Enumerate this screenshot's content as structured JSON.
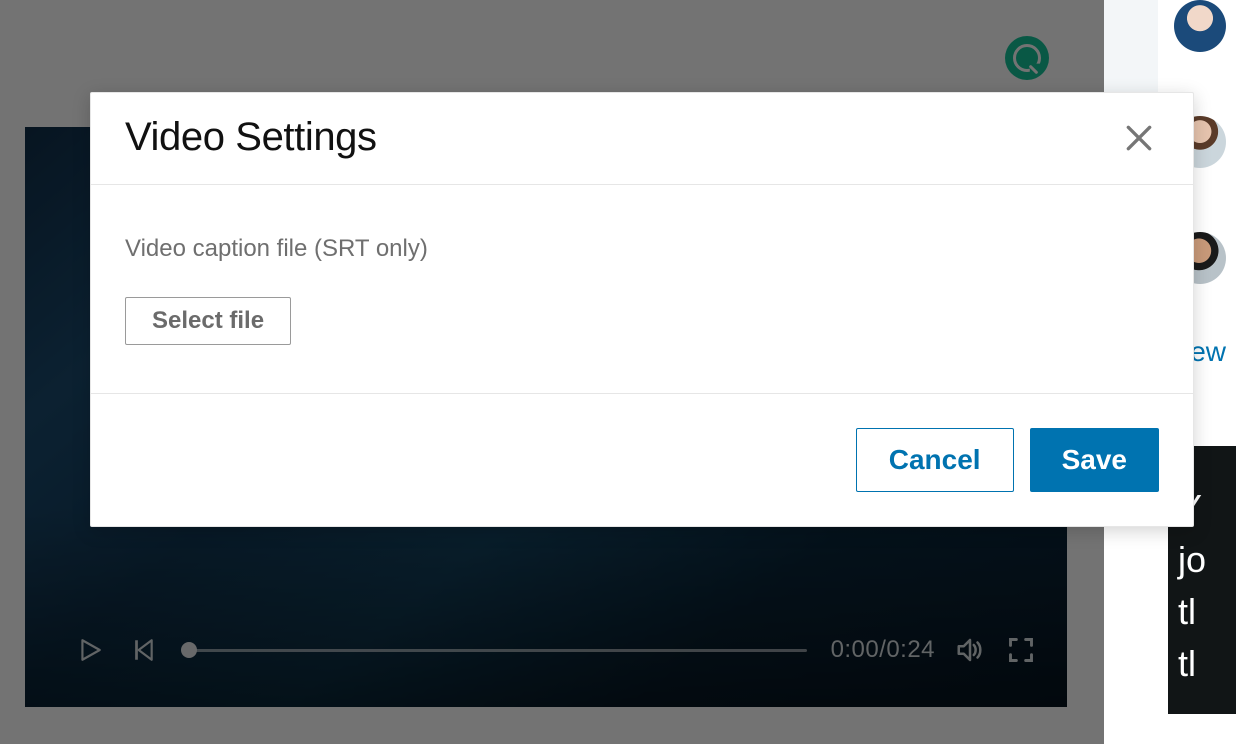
{
  "modal": {
    "title": "Video Settings",
    "caption_label": "Video caption file (SRT only)",
    "select_file_label": "Select file",
    "cancel_label": "Cancel",
    "save_label": "Save"
  },
  "video": {
    "current_time": "0:00",
    "duration": "0:24"
  },
  "sidebar": {
    "link_text": "iew",
    "dark_card_text_lines": [
      "Y",
      "jo",
      "tl",
      "tl"
    ]
  },
  "icons": {
    "close": "close-icon",
    "play": "play-icon",
    "previous": "previous-track-icon",
    "volume": "volume-icon",
    "fullscreen": "fullscreen-icon",
    "grammarly": "grammarly-badge-icon"
  }
}
